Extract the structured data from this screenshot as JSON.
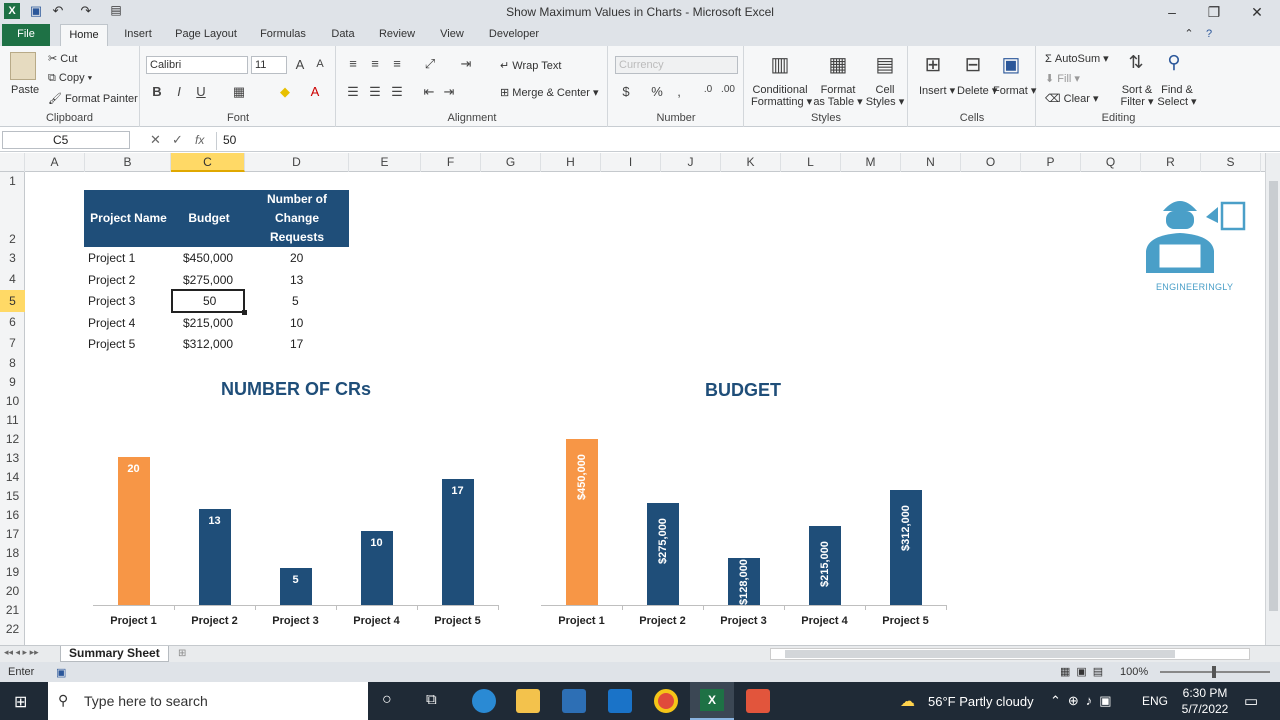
{
  "window": {
    "title": "Show Maximum Values in Charts  -  Microsoft Excel"
  },
  "tabs": [
    "File",
    "Home",
    "Insert",
    "Page Layout",
    "Formulas",
    "Data",
    "Review",
    "View",
    "Developer"
  ],
  "ribbon": {
    "clipboard": {
      "label": "Clipboard",
      "paste": "Paste",
      "cut": "Cut",
      "copy": "Copy",
      "format_painter": "Format Painter"
    },
    "font": {
      "label": "Font",
      "name": "Calibri",
      "size": "11"
    },
    "alignment": {
      "label": "Alignment",
      "wrap": "Wrap Text",
      "merge": "Merge & Center"
    },
    "number": {
      "label": "Number",
      "format": "Currency",
      "dollar": "$",
      "percent": "%",
      "comma": ","
    },
    "styles": {
      "label": "Styles",
      "conditional": "Conditional",
      "conditional2": "Formatting",
      "format_table": "Format",
      "format_table2": "as Table",
      "cell_styles": "Cell",
      "cell_styles2": "Styles"
    },
    "cells": {
      "label": "Cells",
      "insert": "Insert",
      "delete": "Delete",
      "format": "Format"
    },
    "editing": {
      "label": "Editing",
      "autosum": "AutoSum",
      "fill": "Fill",
      "clear": "Clear",
      "sort": "Sort &",
      "sort2": "Filter",
      "find": "Find &",
      "find2": "Select"
    }
  },
  "formula_bar": {
    "name_box": "C5",
    "fx": "fx",
    "value": "50"
  },
  "columns": [
    "A",
    "B",
    "C",
    "D",
    "E",
    "F",
    "G",
    "H",
    "I",
    "J",
    "K",
    "L",
    "M",
    "N",
    "O",
    "P",
    "Q",
    "R",
    "S"
  ],
  "rows": [
    "1",
    "2",
    "3",
    "4",
    "5",
    "6",
    "7",
    "8",
    "9",
    "10",
    "11",
    "12",
    "13",
    "14",
    "15",
    "16",
    "17",
    "18",
    "19",
    "20",
    "21",
    "22"
  ],
  "table": {
    "headers": [
      "Project Name",
      "Budget",
      "Number of Change Requests"
    ],
    "rows": [
      [
        "Project 1",
        "$450,000",
        "20"
      ],
      [
        "Project 2",
        "$275,000",
        "13"
      ],
      [
        "Project 3",
        "50",
        "5"
      ],
      [
        "Project 4",
        "$215,000",
        "10"
      ],
      [
        "Project 5",
        "$312,000",
        "17"
      ]
    ]
  },
  "logo": {
    "text": "ENGINEERINGLY"
  },
  "chart_data": [
    {
      "type": "bar",
      "title": "NUMBER OF CRs",
      "categories": [
        "Project 1",
        "Project 2",
        "Project 3",
        "Project 4",
        "Project 5"
      ],
      "values": [
        20,
        13,
        5,
        10,
        17
      ],
      "labels": [
        "20",
        "13",
        "5",
        "10",
        "17"
      ],
      "highlight_color": "#f79646",
      "bar_color": "#1f4e79",
      "ylim": [
        0,
        22
      ]
    },
    {
      "type": "bar",
      "title": "BUDGET",
      "categories": [
        "Project 1",
        "Project 2",
        "Project 3",
        "Project 4",
        "Project 5"
      ],
      "values": [
        450000,
        275000,
        128000,
        215000,
        312000
      ],
      "labels": [
        "$450,000",
        "$275,000",
        "$128,000",
        "$215,000",
        "$312,000"
      ],
      "highlight_color": "#f79646",
      "bar_color": "#1f4e79",
      "ylim": [
        0,
        495000
      ]
    }
  ],
  "sheet": {
    "tab": "Summary Sheet"
  },
  "status": {
    "mode": "Enter",
    "zoom": "100%"
  },
  "taskbar": {
    "search": "Type here to search",
    "weather": "56°F  Partly cloudy",
    "lang": "ENG",
    "time": "6:30 PM",
    "date": "5/7/2022"
  }
}
